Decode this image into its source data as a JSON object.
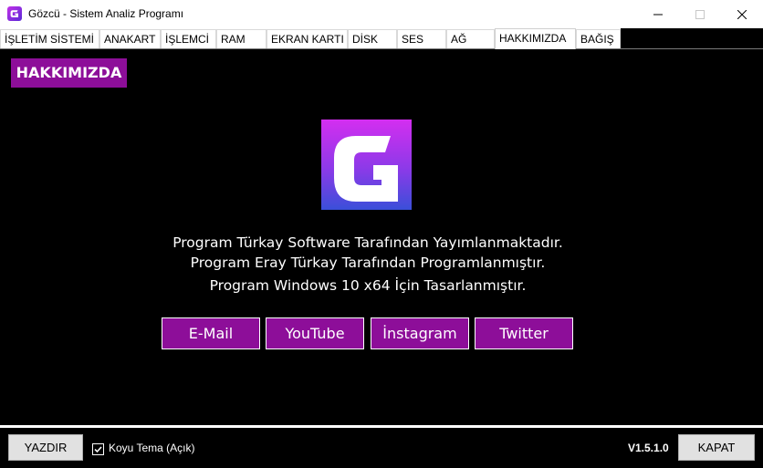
{
  "window": {
    "title": "Gözcü - Sistem Analiz Programı",
    "app_icon": "g-logo-icon",
    "controls": [
      "minimize-icon",
      "maximize-icon",
      "close-icon"
    ]
  },
  "tabs": [
    {
      "label": "İŞLETİM SİSTEMİ",
      "active": false
    },
    {
      "label": "ANAKART",
      "active": false
    },
    {
      "label": "İŞLEMCİ",
      "active": false
    },
    {
      "label": "RAM",
      "active": false
    },
    {
      "label": "EKRAN KARTI",
      "active": false
    },
    {
      "label": "DİSK",
      "active": false
    },
    {
      "label": "SES",
      "active": false
    },
    {
      "label": "AĞ",
      "active": false
    },
    {
      "label": "HAKKIMIZDA",
      "active": true
    },
    {
      "label": "BAĞIŞ",
      "active": false
    }
  ],
  "about": {
    "section_label": "HAKKIMIZDA",
    "lines": [
      "Program Türkay Software Tarafından Yayımlanmaktadır.",
      "Program Eray Türkay Tarafından Programlanmıştır.",
      "Program Windows 10 x64 İçin Tasarlanmıştır."
    ],
    "links": [
      "E-Mail",
      "YouTube",
      "İnstagram",
      "Twitter"
    ]
  },
  "footer": {
    "print_label": "YAZDIR",
    "dark_theme_label": "Koyu Tema (Açık)",
    "dark_theme_checked": true,
    "version": "V1.5.1.0",
    "close_label": "KAPAT"
  },
  "colors": {
    "accent": "#8d0e99",
    "background": "#000000",
    "text": "#ffffff"
  }
}
